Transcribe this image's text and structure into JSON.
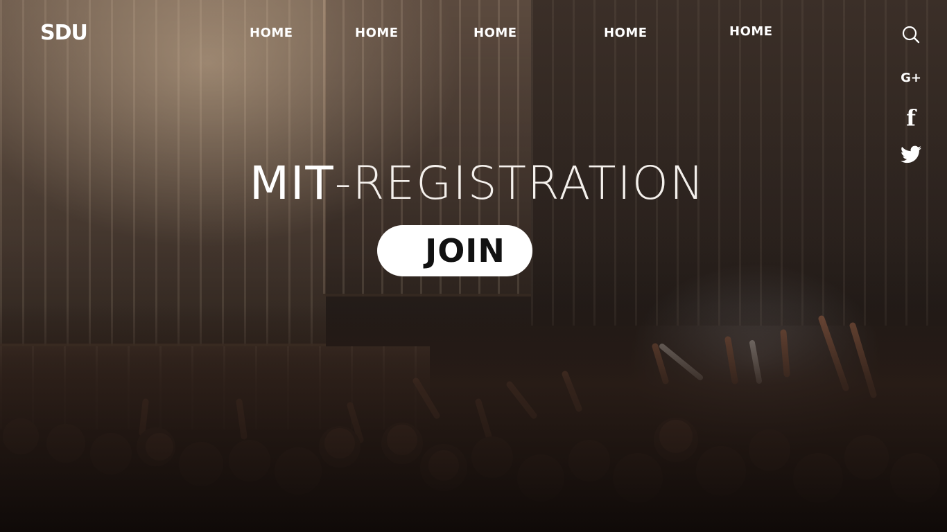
{
  "brand": {
    "logo_text": "SDU"
  },
  "nav": {
    "items": [
      {
        "label": "HOME"
      },
      {
        "label": "HOME"
      },
      {
        "label": "HOME"
      },
      {
        "label": "HOME"
      },
      {
        "label": "HOME"
      }
    ]
  },
  "header": {
    "search_icon": "search-icon"
  },
  "social": {
    "google_plus_label": "G+",
    "facebook_label": "f",
    "twitter_icon": "twitter-icon"
  },
  "hero": {
    "title_part1": "MIT",
    "title_part2": "-REGISTRATION",
    "join_label": "JOIN"
  },
  "colors": {
    "text": "#ffffff",
    "button_bg": "#ffffff",
    "button_text": "#111111"
  }
}
